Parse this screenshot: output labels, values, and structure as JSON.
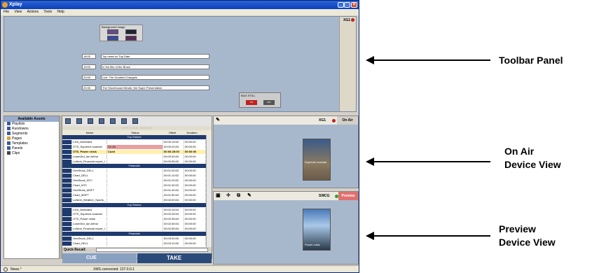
{
  "window": {
    "title": "Xplay",
    "buttons": [
      "_",
      "□",
      "✕"
    ]
  },
  "menu": [
    "File",
    "View",
    "Actions",
    "Tools",
    "Help"
  ],
  "toolbar_panel": {
    "device": "XG1",
    "bg_image_label": "Background Image",
    "text_rows": [
      {
        "time": "18:00",
        "text": "Top news on Top Date"
      },
      {
        "time": "19:00",
        "text": "In the film of the Bruce"
      },
      {
        "time": "20:00",
        "text": "Live: The Doubles Evangels"
      },
      {
        "time": "20:30",
        "text": "The Stovehouse Minute, the Super Presentation"
      }
    ],
    "bug": {
      "label": "BUG STILL",
      "on": "ON",
      "off": "OFF"
    }
  },
  "assets": {
    "title": "Available Assets",
    "items": [
      "Playlists",
      "Rundowns",
      "Segments",
      "Pages",
      "Templates",
      "Panels",
      "Clips"
    ]
  },
  "playlist": {
    "banner": "VERTIGO MEDIA",
    "columns": [
      "Name",
      "Status",
      "Offset",
      "Duration"
    ],
    "rows": [
      {
        "group": "Top Stories"
      },
      {
        "name": "L3rd_Animated",
        "status": "",
        "offset": "00:00:15:00",
        "duration": "00:00:00"
      },
      {
        "name": "OTS_Supreme scandal",
        "status": "On Air",
        "offset": "00:00:20:00",
        "duration": "00:00:00",
        "onair": true
      },
      {
        "name": "OTS_Power crisis",
        "status": "Cued",
        "offset": "00:00:25:00",
        "duration": "00:00:00",
        "cued": true
      },
      {
        "name": "Lower3rd_Ian Arthur",
        "status": "",
        "offset": "00:00:40:00",
        "duration": "00:00:00"
      },
      {
        "name": "LoNext_Financial report_I",
        "status": "",
        "offset": "00:00:55:00",
        "duration": "00:00:00"
      },
      {
        "group": "Financial"
      },
      {
        "name": "OneStock_DELL",
        "status": "",
        "offset": "00:01:00:02",
        "duration": "00:00:00"
      },
      {
        "name": "Chart_DELL",
        "status": "",
        "offset": "00:01:10:02",
        "duration": "00:00:00"
      },
      {
        "name": "OneStock_NTC",
        "status": "",
        "offset": "00:01:20:02",
        "duration": "00:00:00"
      },
      {
        "name": "Chart_NTC",
        "status": "",
        "offset": "00:01:30:02",
        "duration": "00:00:00"
      },
      {
        "name": "OneStock_MSFT",
        "status": "",
        "offset": "00:01:40:02",
        "duration": "00:00:00"
      },
      {
        "name": "Chart_MSFT",
        "status": "",
        "offset": "00:01:50:02",
        "duration": "00:00:00"
      },
      {
        "name": "LoNext_Weather_Sports_",
        "status": "",
        "offset": "00:02:00:04",
        "duration": "00:00:00"
      },
      {
        "group": "Top Stories"
      },
      {
        "name": "L3rd_Animated",
        "status": "",
        "offset": "00:02:15:04",
        "duration": "00:00:00"
      },
      {
        "name": "OTS_Supreme scandal",
        "status": "",
        "offset": "00:02:25:04",
        "duration": "00:00:00"
      },
      {
        "name": "OTS_Power crisis",
        "status": "",
        "offset": "00:02:35:04",
        "duration": "00:00:00"
      },
      {
        "name": "Lower3rd_Ian Arthur",
        "status": "",
        "offset": "00:02:45:04",
        "duration": "00:00:00"
      },
      {
        "name": "LoNext_Financial report_I",
        "status": "",
        "offset": "00:02:55:04",
        "duration": "00:00:00"
      },
      {
        "group": "Financial"
      },
      {
        "name": "OneStock_DELL",
        "status": "",
        "offset": "00:03:00:00",
        "duration": "00:00:00"
      },
      {
        "name": "Chart_DELL",
        "status": "",
        "offset": "00:03:10:00",
        "duration": "00:00:00"
      }
    ],
    "quick_recall": "Quick Recall:",
    "cue": "CUE",
    "take": "TAKE"
  },
  "onair_view": {
    "device": "XG1",
    "tab": "On Air",
    "thumb_caption": "Supreme scandal"
  },
  "preview_view": {
    "device": "SWCG",
    "tab": "Preview",
    "thumb_caption": "Power crisis"
  },
  "statusbar": {
    "tab": "News *",
    "message": "XMS connected: 127.0.0.1"
  },
  "callouts": {
    "toolbar": "Toolbar Panel",
    "onair": [
      "On Air",
      "Device View"
    ],
    "preview": [
      "Preview",
      "Device View"
    ]
  }
}
